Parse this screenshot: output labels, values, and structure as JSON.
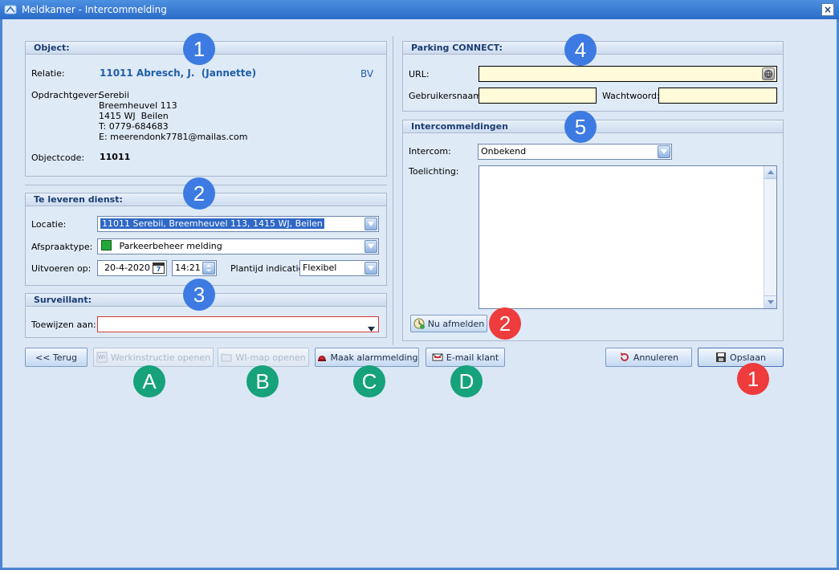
{
  "window": {
    "title": "Meldkamer - Intercommelding",
    "close_icon": "close-icon"
  },
  "object": {
    "header": "Object:",
    "relatie_label": "Relatie:",
    "relatie_value": "11011 Abresch, J.  (Jannette)",
    "relatie_type": "BV",
    "opdrachtgever_label": "Opdrachtgever:",
    "opdrachtgever_lines": [
      "Serebii",
      "Breemheuvel 113",
      "1415 WJ  Beilen",
      "T: 0779-684683",
      "E: meerendonk7781@mailas.com"
    ],
    "objectcode_label": "Objectcode:",
    "objectcode_value": "11011"
  },
  "dienst": {
    "header": "Te leveren dienst:",
    "locatie_label": "Locatie:",
    "locatie_value": "11011 Serebii, Breemheuvel 113, 1415 WJ, Beilen",
    "afspraaktype_label": "Afspraaktype:",
    "afspraaktype_value": "Parkeerbeheer melding",
    "afspraaktype_color": "#22a83a",
    "uitvoeren_label": "Uitvoeren op:",
    "date_value": "20-4-2020",
    "time_value": "14:21",
    "plantijd_label": "Plantijd indicatie:",
    "plantijd_value": "Flexibel"
  },
  "surveillant": {
    "header": "Surveillant:",
    "toewijzen_label": "Toewijzen aan:",
    "toewijzen_value": ""
  },
  "parking": {
    "header": "Parking CONNECT:",
    "url_label": "URL:",
    "url_value": "",
    "gebruikersnaam_label": "Gebruikersnaam:",
    "gebruikersnaam_value": "",
    "wachtwoord_label": "Wachtwoord:",
    "wachtwoord_value": ""
  },
  "intercom": {
    "header": "Intercommeldingen",
    "intercom_label": "Intercom:",
    "intercom_value": "Onbekend",
    "toelichting_label": "Toelichting:",
    "toelichting_value": "",
    "nu_afmelden": "Nu afmelden"
  },
  "buttons": {
    "terug": "<< Terug",
    "werkinstructie": "Werkinstructie openen",
    "wimap": "WI-map openen",
    "alarm": "Maak alarmmelding",
    "email": "E-mail klant",
    "annuleren": "Annuleren",
    "opslaan": "Opslaan"
  },
  "badges": {
    "b1": "1",
    "b2": "2",
    "b3": "3",
    "b4": "4",
    "b5": "5",
    "r1": "1",
    "r2": "2",
    "a": "A",
    "b": "B",
    "c": "C",
    "d": "D"
  },
  "colors": {
    "accent": "#3d7be2",
    "badge_red": "#ee3b3b",
    "badge_green": "#16a27a",
    "title_blue": "#1c3d72"
  }
}
